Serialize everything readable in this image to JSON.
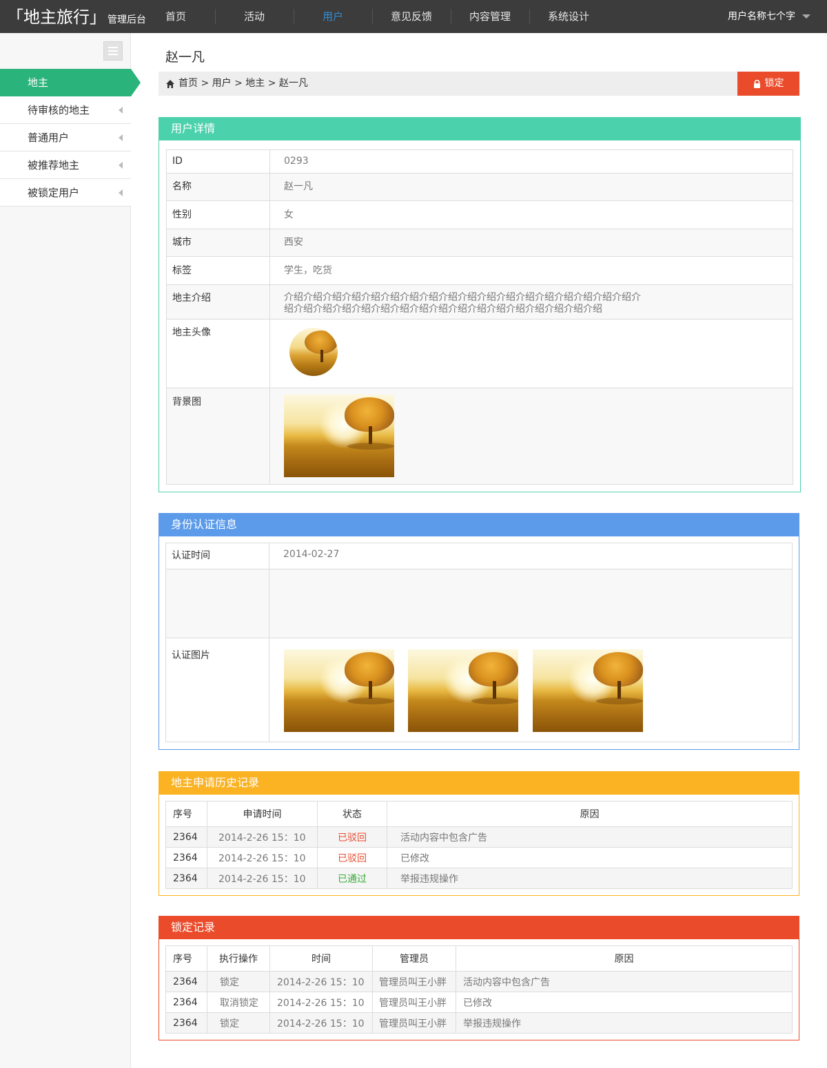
{
  "app": {
    "logo_main": "「地主旅行」",
    "logo_sub": "管理后台",
    "nav": [
      "首页",
      "活动",
      "用户",
      "意见反馈",
      "内容管理",
      "系统设计"
    ],
    "nav_active_index": 2,
    "user_name": "用户名称七个字"
  },
  "sidebar": {
    "items": [
      {
        "label": "地主",
        "active": true
      },
      {
        "label": "待审核的地主",
        "active": false
      },
      {
        "label": "普通用户",
        "active": false
      },
      {
        "label": "被推荐地主",
        "active": false
      },
      {
        "label": "被锁定用户",
        "active": false
      }
    ]
  },
  "page": {
    "title": "赵一凡",
    "breadcrumb": "首页 > 用户 > 地主 > 赵一凡",
    "lock_label": "锁定"
  },
  "colors": {
    "accent_green": "#2ab37a",
    "panel_teal": "#4cd1ad",
    "panel_blue": "#5b9bea",
    "panel_yellow": "#fbb223",
    "panel_red": "#ea4c2b",
    "nav_active": "#2f8fd8",
    "status_rejected": "#e84c30",
    "status_passed": "#3aab3a"
  },
  "user_detail": {
    "title": "用户详情",
    "fields": [
      {
        "key": "ID",
        "value": "0293"
      },
      {
        "key": "名称",
        "value": "赵一凡"
      },
      {
        "key": "性别",
        "value": "女"
      },
      {
        "key": "城市",
        "value": "西安"
      },
      {
        "key": "标签",
        "value": "学生，吃货"
      },
      {
        "key": "地主介绍",
        "value": "介绍介绍介绍介绍介绍介绍介绍介绍介绍介绍介绍介绍介绍介绍介绍介绍介绍介绍介绍介绍介绍介绍介绍介绍介绍介绍介绍介绍介绍介绍介绍介绍介绍介绍介绍"
      }
    ],
    "avatar_label": "地主头像",
    "background_label": "背景图"
  },
  "identity": {
    "title": "身份认证信息",
    "time_label": "认证时间",
    "time_value": "2014-02-27",
    "images_label": "认证图片"
  },
  "apply_history": {
    "title": "地主申请历史记录",
    "columns": [
      "序号",
      "申请时间",
      "状态",
      "原因"
    ],
    "rows": [
      {
        "id": "2364",
        "time": "2014-2-26  15：10",
        "status": "已驳回",
        "status_type": "rejected",
        "reason": "活动内容中包含广告"
      },
      {
        "id": "2364",
        "time": "2014-2-26  15：10",
        "status": "已驳回",
        "status_type": "rejected",
        "reason": "已修改"
      },
      {
        "id": "2364",
        "time": "2014-2-26  15：10",
        "status": "已通过",
        "status_type": "passed",
        "reason": "举报违规操作"
      }
    ]
  },
  "lock_history": {
    "title": "锁定记录",
    "columns": [
      "序号",
      "执行操作",
      "时间",
      "管理员",
      "原因"
    ],
    "rows": [
      {
        "id": "2364",
        "action": "锁定",
        "time": "2014-2-26  15：10",
        "admin": "管理员叫王小胖",
        "reason": "活动内容中包含广告"
      },
      {
        "id": "2364",
        "action": "取消锁定",
        "time": "2014-2-26  15：10",
        "admin": "管理员叫王小胖",
        "reason": "已修改"
      },
      {
        "id": "2364",
        "action": "锁定",
        "time": "2014-2-26  15：10",
        "admin": "管理员叫王小胖",
        "reason": "举报违规操作"
      }
    ]
  }
}
